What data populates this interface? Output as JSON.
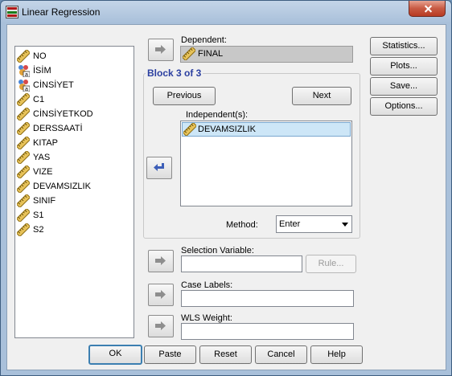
{
  "window": {
    "title": "Linear Regression"
  },
  "variables": [
    {
      "name": "NO",
      "type": "scale"
    },
    {
      "name": "İSİM",
      "type": "nominal-string"
    },
    {
      "name": "CİNSİYET",
      "type": "nominal-string"
    },
    {
      "name": "C1",
      "type": "scale"
    },
    {
      "name": "CİNSİYETKOD",
      "type": "scale"
    },
    {
      "name": "DERSSAATİ",
      "type": "scale"
    },
    {
      "name": "KITAP",
      "type": "scale"
    },
    {
      "name": "YAS",
      "type": "scale"
    },
    {
      "name": "VIZE",
      "type": "scale"
    },
    {
      "name": "DEVAMSIZLIK",
      "type": "scale"
    },
    {
      "name": "SINIF",
      "type": "scale"
    },
    {
      "name": "S1",
      "type": "scale"
    },
    {
      "name": "S2",
      "type": "scale"
    }
  ],
  "dependent": {
    "label": "Dependent:",
    "value": "FINAL"
  },
  "block": {
    "title": "Block 3 of 3",
    "previous_label": "Previous",
    "next_label": "Next",
    "independents_label": "Independent(s):",
    "independents": [
      "DEVAMSIZLIK"
    ],
    "method_label": "Method:",
    "method_value": "Enter"
  },
  "selection_variable": {
    "label": "Selection Variable:",
    "value": "",
    "rule_label": "Rule..."
  },
  "case_labels": {
    "label": "Case Labels:",
    "value": ""
  },
  "wls_weight": {
    "label": "WLS Weight:",
    "value": ""
  },
  "side_buttons": {
    "statistics": "Statistics...",
    "plots": "Plots...",
    "save": "Save...",
    "options": "Options..."
  },
  "bottom_buttons": {
    "ok": "OK",
    "paste": "Paste",
    "reset": "Reset",
    "cancel": "Cancel",
    "help": "Help"
  }
}
